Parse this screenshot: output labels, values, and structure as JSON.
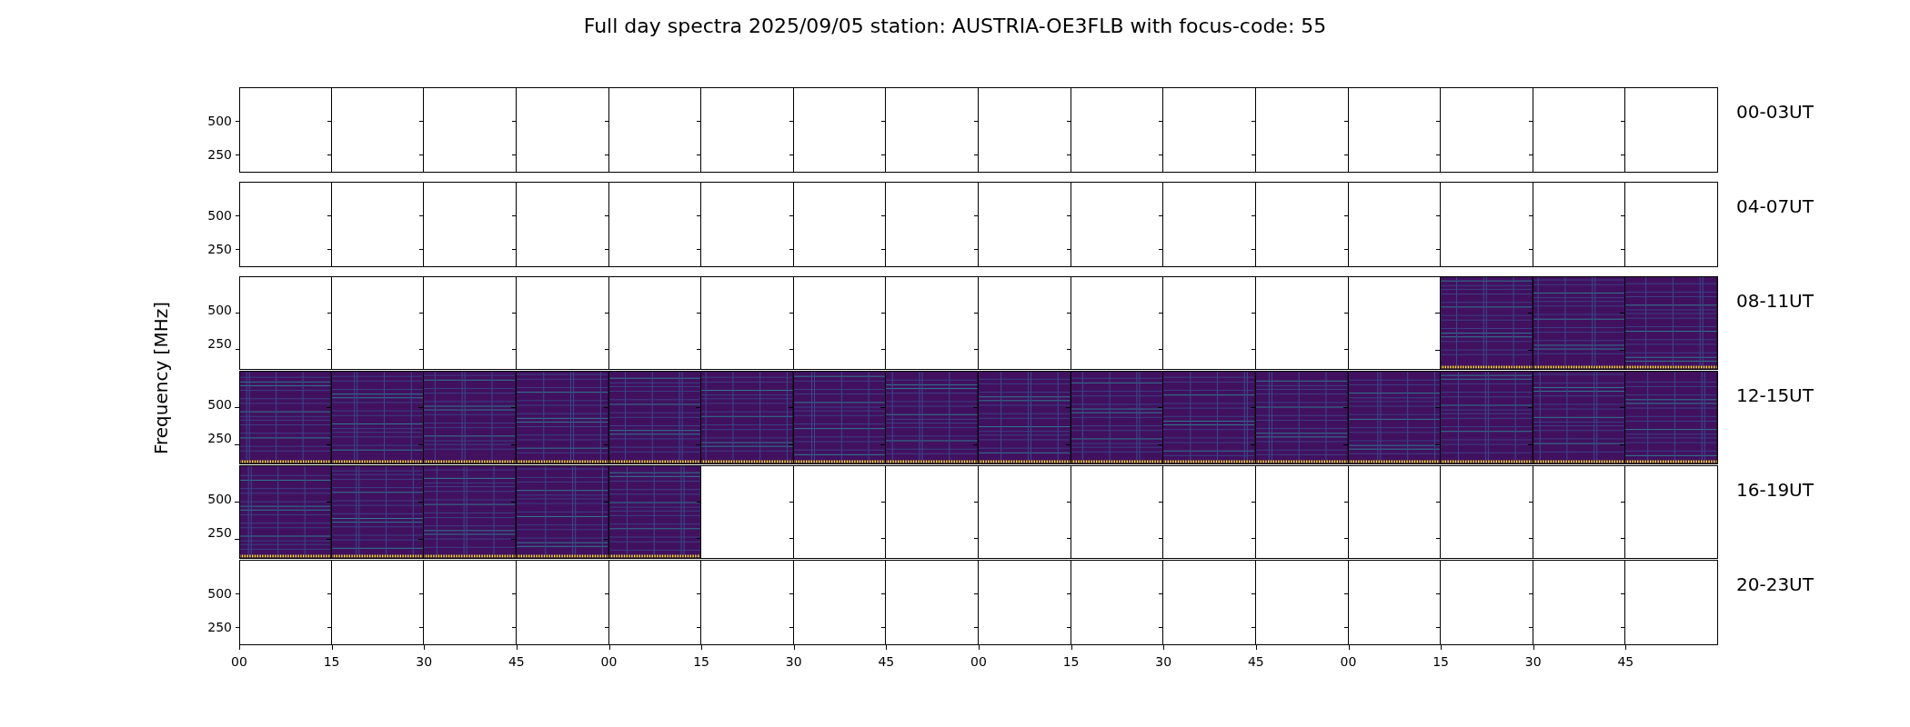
{
  "title": "Full day spectra 2025/09/05 station: AUSTRIA-OE3FLB with focus-code: 55",
  "ylabel": "Frequency [MHz]",
  "xticks": [
    "00",
    "15",
    "30",
    "45",
    "00",
    "15",
    "30",
    "45",
    "00",
    "15",
    "30",
    "45",
    "00",
    "15",
    "30",
    "45"
  ],
  "rows": [
    {
      "label": "00-03UT",
      "yticks": [
        "500",
        "250"
      ],
      "panels": [
        {
          "has_data": false
        },
        {
          "has_data": false
        },
        {
          "has_data": false
        },
        {
          "has_data": false
        },
        {
          "has_data": false
        },
        {
          "has_data": false
        },
        {
          "has_data": false
        },
        {
          "has_data": false
        },
        {
          "has_data": false
        },
        {
          "has_data": false
        },
        {
          "has_data": false
        },
        {
          "has_data": false
        },
        {
          "has_data": false
        },
        {
          "has_data": false
        },
        {
          "has_data": false
        },
        {
          "has_data": false
        }
      ]
    },
    {
      "label": "04-07UT",
      "yticks": [
        "500",
        "250"
      ],
      "panels": [
        {
          "has_data": false
        },
        {
          "has_data": false
        },
        {
          "has_data": false
        },
        {
          "has_data": false
        },
        {
          "has_data": false
        },
        {
          "has_data": false
        },
        {
          "has_data": false
        },
        {
          "has_data": false
        },
        {
          "has_data": false
        },
        {
          "has_data": false
        },
        {
          "has_data": false
        },
        {
          "has_data": false
        },
        {
          "has_data": false
        },
        {
          "has_data": false
        },
        {
          "has_data": false
        },
        {
          "has_data": false
        }
      ]
    },
    {
      "label": "08-11UT",
      "yticks": [
        "500",
        "250"
      ],
      "panels": [
        {
          "has_data": false
        },
        {
          "has_data": false
        },
        {
          "has_data": false
        },
        {
          "has_data": false
        },
        {
          "has_data": false
        },
        {
          "has_data": false
        },
        {
          "has_data": false
        },
        {
          "has_data": false
        },
        {
          "has_data": false
        },
        {
          "has_data": false
        },
        {
          "has_data": false
        },
        {
          "has_data": false
        },
        {
          "has_data": false
        },
        {
          "has_data": true
        },
        {
          "has_data": true
        },
        {
          "has_data": true
        }
      ]
    },
    {
      "label": "12-15UT",
      "yticks": [
        "500",
        "250"
      ],
      "panels": [
        {
          "has_data": true
        },
        {
          "has_data": true
        },
        {
          "has_data": true
        },
        {
          "has_data": true
        },
        {
          "has_data": true
        },
        {
          "has_data": true
        },
        {
          "has_data": true
        },
        {
          "has_data": true
        },
        {
          "has_data": true
        },
        {
          "has_data": true
        },
        {
          "has_data": true
        },
        {
          "has_data": true
        },
        {
          "has_data": true
        },
        {
          "has_data": true
        },
        {
          "has_data": true
        },
        {
          "has_data": true
        }
      ]
    },
    {
      "label": "16-19UT",
      "yticks": [
        "500",
        "250"
      ],
      "panels": [
        {
          "has_data": true
        },
        {
          "has_data": true
        },
        {
          "has_data": true
        },
        {
          "has_data": true
        },
        {
          "has_data": true
        },
        {
          "has_data": false
        },
        {
          "has_data": false
        },
        {
          "has_data": false
        },
        {
          "has_data": false
        },
        {
          "has_data": false
        },
        {
          "has_data": false
        },
        {
          "has_data": false
        },
        {
          "has_data": false
        },
        {
          "has_data": false
        },
        {
          "has_data": false
        },
        {
          "has_data": false
        }
      ]
    },
    {
      "label": "20-23UT",
      "yticks": [
        "500",
        "250"
      ],
      "panels": [
        {
          "has_data": false
        },
        {
          "has_data": false
        },
        {
          "has_data": false
        },
        {
          "has_data": false
        },
        {
          "has_data": false
        },
        {
          "has_data": false
        },
        {
          "has_data": false
        },
        {
          "has_data": false
        },
        {
          "has_data": false
        },
        {
          "has_data": false
        },
        {
          "has_data": false
        },
        {
          "has_data": false
        },
        {
          "has_data": false
        },
        {
          "has_data": false
        },
        {
          "has_data": false
        },
        {
          "has_data": false
        }
      ]
    }
  ]
}
